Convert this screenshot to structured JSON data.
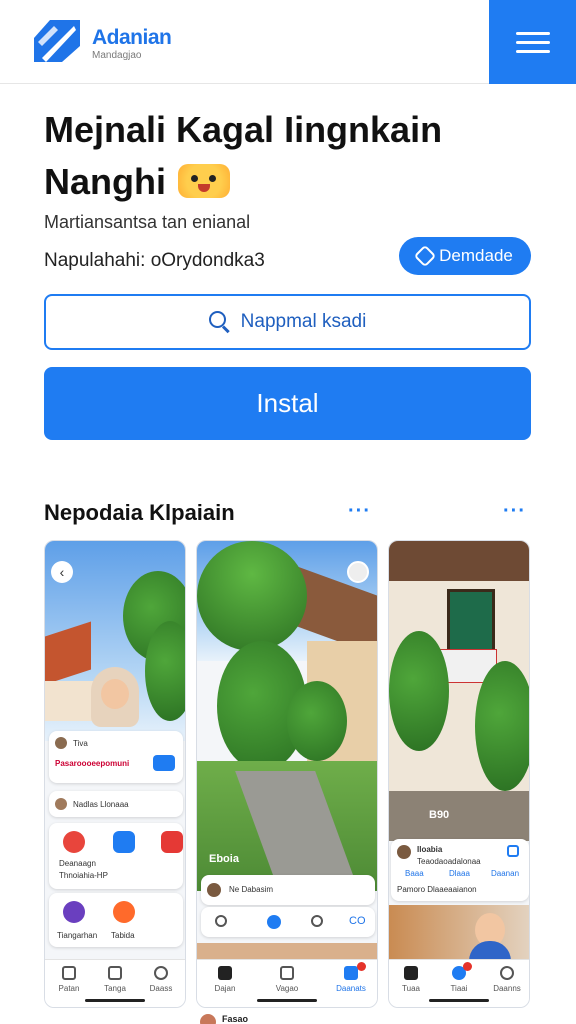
{
  "header": {
    "brand_name": "Adanian",
    "brand_sub": "Mandagjao"
  },
  "hero": {
    "title": "Mejnali Kagal Iingnkain Nanghi",
    "subtitle1": "Martiansantsa tan enianal",
    "subtitle2": "Napulahahi: oOrydondka3",
    "pill_label": "Demdade"
  },
  "search": {
    "placeholder": "Nappmal ksadi"
  },
  "install": {
    "label": "Instal"
  },
  "section": {
    "title": "Nepodaia Klpaiain",
    "more": "···"
  },
  "screens": [
    {
      "rows": [
        "Tiva",
        "Pasaroooeepomuni",
        "Nadlas Llonaaa",
        "Deanaagn",
        "Thnoiahia-HP",
        "Tiangarhan",
        "Tabida"
      ],
      "tabs": [
        "Patan",
        "Tanga",
        "Daass"
      ]
    },
    {
      "overlay_label": "Eboia",
      "card_name": "Ne Dabasim",
      "tabs": [
        "Dajan",
        "Vagao",
        "Daanats"
      ]
    },
    {
      "overlay_label": "B90",
      "card_title": "Iloabia",
      "card_line1": "Teaodaoadalonaa",
      "card_row": [
        "Baaa",
        "Dlaaa",
        "Daanan"
      ],
      "card_line2": "Pamoro Dlaaeaaianon",
      "tabs": [
        "Tuaa",
        "Tiaai",
        "Daanns"
      ]
    }
  ],
  "bottom_peek": "Fasao",
  "colors": {
    "accent": "#1f7cf2",
    "brand": "#1f74e8"
  }
}
